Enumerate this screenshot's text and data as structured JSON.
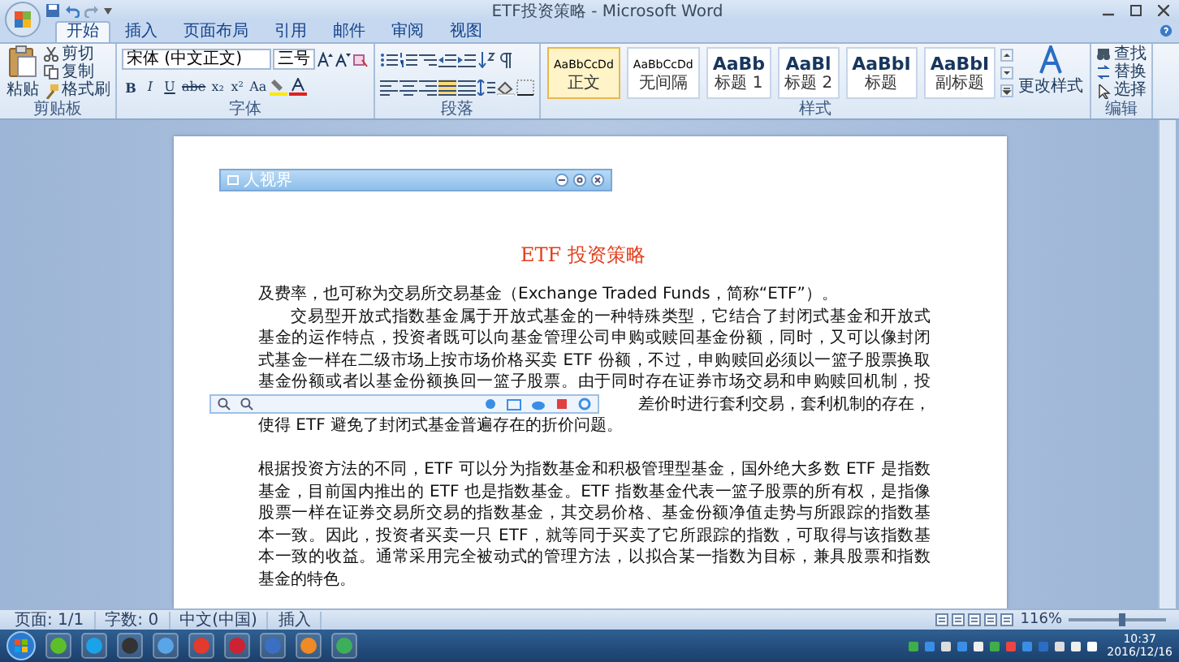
{
  "window": {
    "title": "ETF投资策略 - Microsoft Word"
  },
  "ribbon_tabs": [
    {
      "label": "开始",
      "selected": true
    },
    {
      "label": "插入",
      "selected": false
    },
    {
      "label": "页面布局",
      "selected": false
    },
    {
      "label": "引用",
      "selected": false
    },
    {
      "label": "邮件",
      "selected": false
    },
    {
      "label": "审阅",
      "selected": false
    },
    {
      "label": "视图",
      "selected": false
    }
  ],
  "ribbon": {
    "clipboard": {
      "paste": "粘贴",
      "items": [
        "剪切",
        "复制",
        "格式刷"
      ],
      "group": "剪贴板"
    },
    "font": {
      "name": "宋体 (中文正文)",
      "size": "三号",
      "format_buttons": [
        "B",
        "I",
        "U",
        "abe",
        "x₂",
        "x²",
        "Aa"
      ],
      "group": "字体"
    },
    "paragraph": {
      "group": "段落"
    },
    "styles": {
      "items": [
        {
          "sample": "AaBbCcDd",
          "label": "正文",
          "selected": true
        },
        {
          "sample": "AaBbCcDd",
          "label": "无间隔",
          "selected": false
        },
        {
          "sample": "AaBb",
          "label": "标题 1",
          "selected": false
        },
        {
          "sample": "AaBl",
          "label": "标题 2",
          "selected": false
        },
        {
          "sample": "AaBbI",
          "label": "标题",
          "selected": false
        },
        {
          "sample": "AaBbI",
          "label": "副标题",
          "selected": false
        }
      ],
      "change": "更改样式",
      "group": "样式"
    },
    "editing": {
      "items": [
        "查找",
        "替换",
        "选择"
      ],
      "group": "编辑"
    }
  },
  "viewer": {
    "title": "人视界"
  },
  "document": {
    "heading_latin": "ETF",
    "heading": "投资策略",
    "lines": [
      {
        "kind": "last",
        "text": "及费率，也可称为交易所交易基金（Exchange Traded Funds，简称“ETF”）。"
      },
      {
        "kind": "indent",
        "text": "交易型开放式指数基金属于开放式基金的一种特殊类型，它结合了封闭式基金和开放式"
      },
      {
        "kind": "full",
        "text": "基金的运作特点，投资者既可以向基金管理公司申购或赎回基金份额，同时，又可以像封闭"
      },
      {
        "kind": "full",
        "text": "式基金一样在二级市场上按市场价格买卖 ETF 份额，不过，申购赎回必须以一篮子股票换取"
      },
      {
        "kind": "full",
        "text": "基金份额或者以基金份额换回一篮子股票。由于同时存在证券市场交易和申购赎回机制，投"
      },
      {
        "kind": "covered",
        "text": "差价时进行套利交易，套利机制的存在，"
      },
      {
        "kind": "last",
        "text": "使得 ETF 避免了封闭式基金普遍存在的折价问题。"
      },
      {
        "kind": "blank"
      },
      {
        "kind": "full",
        "text": "根据投资方法的不同，ETF 可以分为指数基金和积极管理型基金，国外绝大多数 ETF 是指数"
      },
      {
        "kind": "full",
        "text": "基金，目前国内推出的 ETF 也是指数基金。ETF 指数基金代表一篮子股票的所有权，是指像"
      },
      {
        "kind": "full",
        "text": "股票一样在证券交易所交易的指数基金，其交易价格、基金份额净值走势与所跟踪的指数基"
      },
      {
        "kind": "full",
        "text": "本一致。因此，投资者买卖一只 ETF，就等同于买卖了它所跟踪的指数，可取得与该指数基"
      },
      {
        "kind": "full",
        "text": "本一致的收益。通常采用完全被动式的管理方法，以拟合某一指数为目标，兼具股票和指数"
      },
      {
        "kind": "last",
        "text": "基金的特色。"
      }
    ]
  },
  "status_bar": {
    "items": [
      "页面: 1/1",
      "字数: 0",
      "中文(中国)",
      "插入"
    ],
    "zoom": {
      "reading": "116%",
      "level": 0.55
    }
  },
  "taskbar": {
    "time": "10:37",
    "date": "2016/12/16"
  }
}
